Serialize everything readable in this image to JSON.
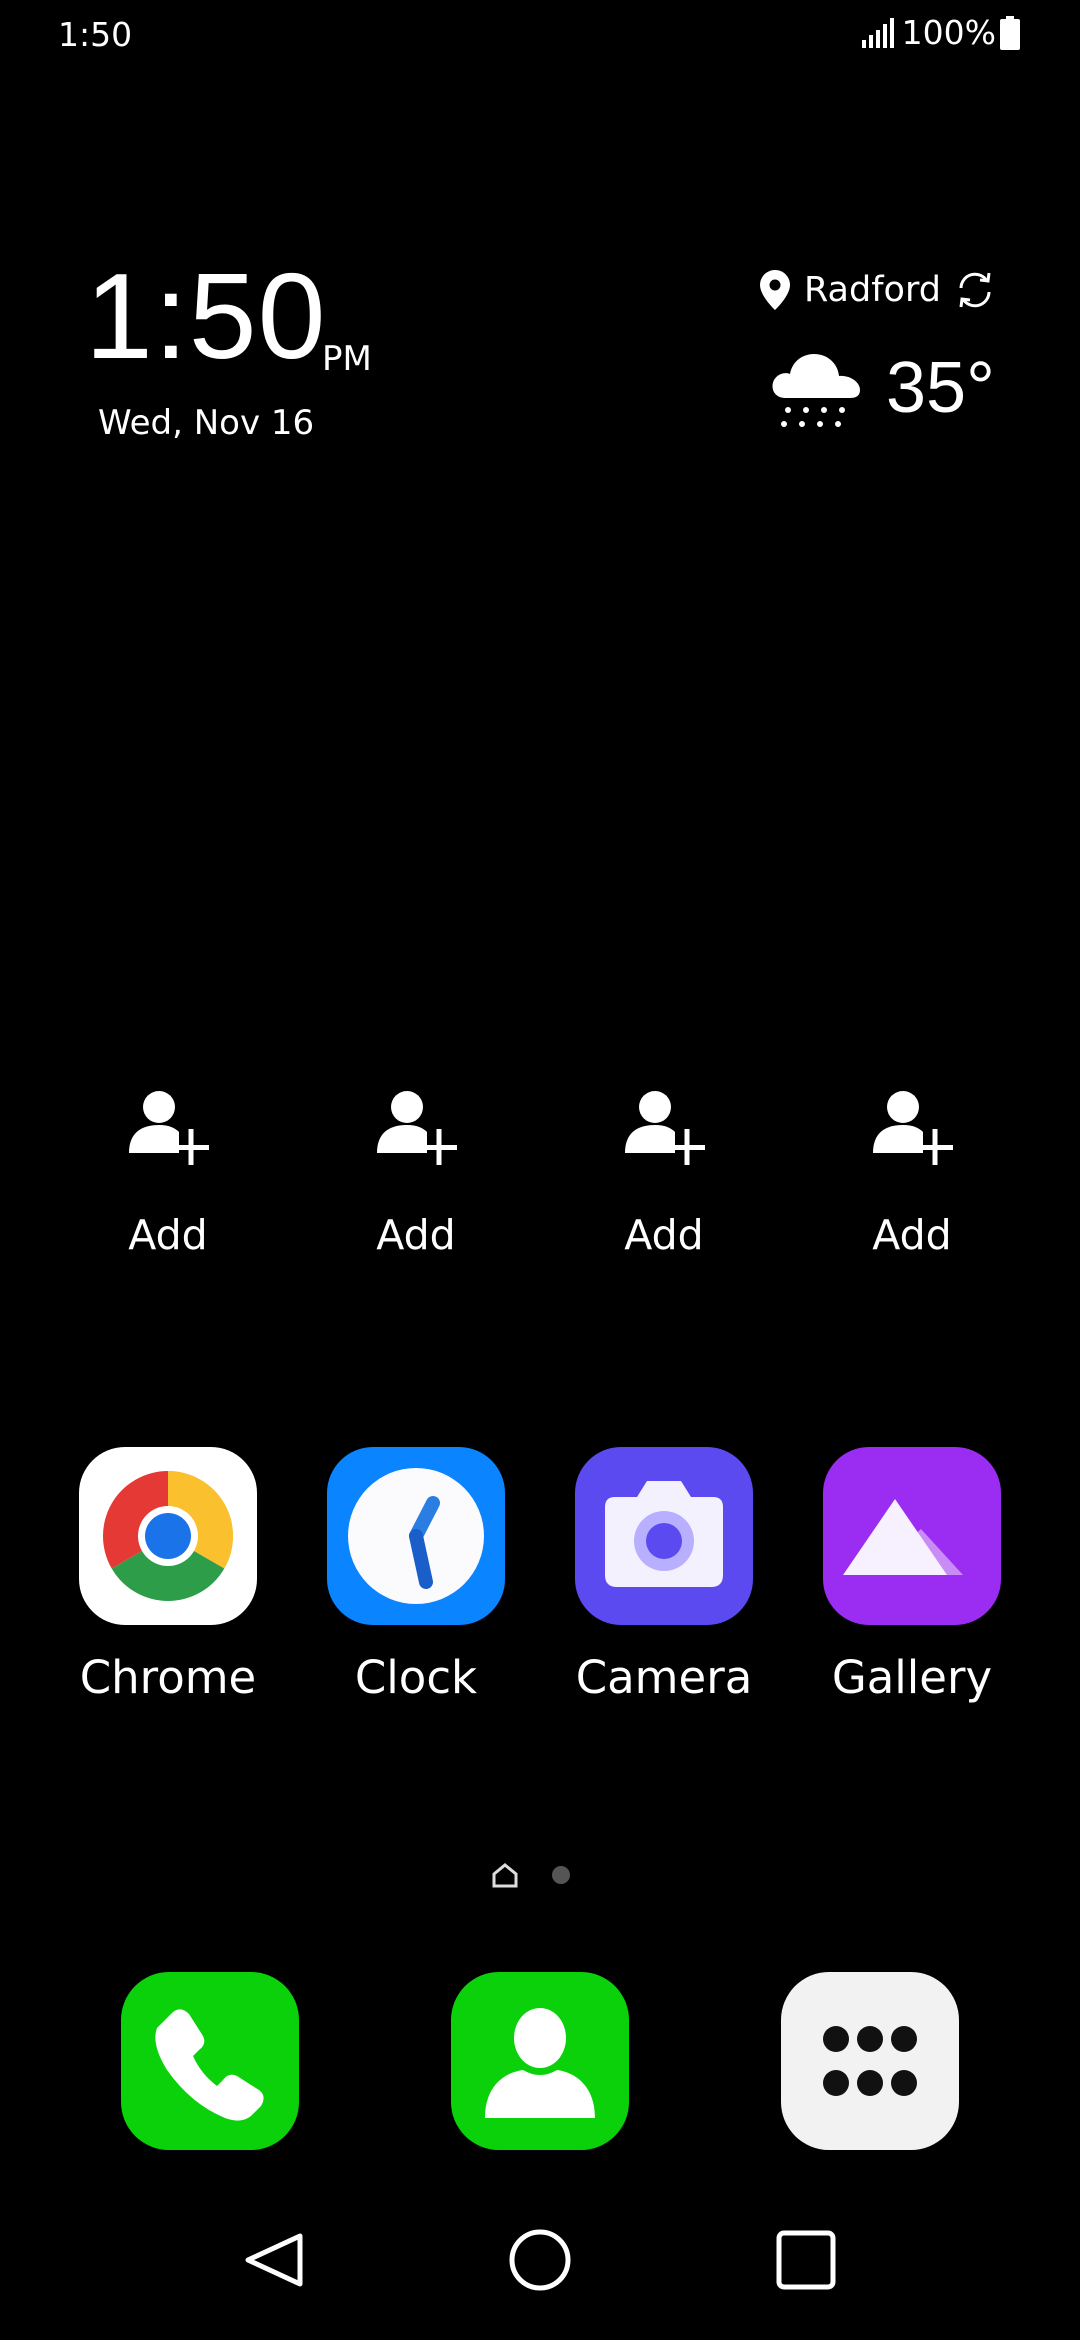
{
  "status_bar": {
    "time": "1:50",
    "battery": "100%",
    "icons": [
      "signal-icon",
      "battery-icon"
    ]
  },
  "clock_widget": {
    "time": "1:50",
    "ampm": "PM",
    "date": "Wed, Nov 16"
  },
  "weather": {
    "location": "Radford",
    "temperature": "35°",
    "condition_icon": "snow-cloud-icon",
    "icons": [
      "location-pin-icon",
      "refresh-icon"
    ]
  },
  "contacts": [
    {
      "label": "Add"
    },
    {
      "label": "Add"
    },
    {
      "label": "Add"
    },
    {
      "label": "Add"
    }
  ],
  "apps": [
    {
      "label": "Chrome",
      "icon": "chrome-icon"
    },
    {
      "label": "Clock",
      "icon": "clock-icon",
      "color": "#0a84ff"
    },
    {
      "label": "Camera",
      "icon": "camera-icon",
      "color": "#5b4af0"
    },
    {
      "label": "Gallery",
      "icon": "gallery-icon",
      "color": "#9b2cf2"
    }
  ],
  "page_indicator": {
    "pages": 2,
    "current": 1
  },
  "dock": [
    {
      "icon": "phone-icon",
      "color": "#0bd10b"
    },
    {
      "icon": "contacts-icon",
      "color": "#0bd10b"
    },
    {
      "icon": "app-drawer-icon",
      "color": "#f2f2f2"
    }
  ],
  "nav": [
    "back-icon",
    "home-icon",
    "recents-icon"
  ]
}
